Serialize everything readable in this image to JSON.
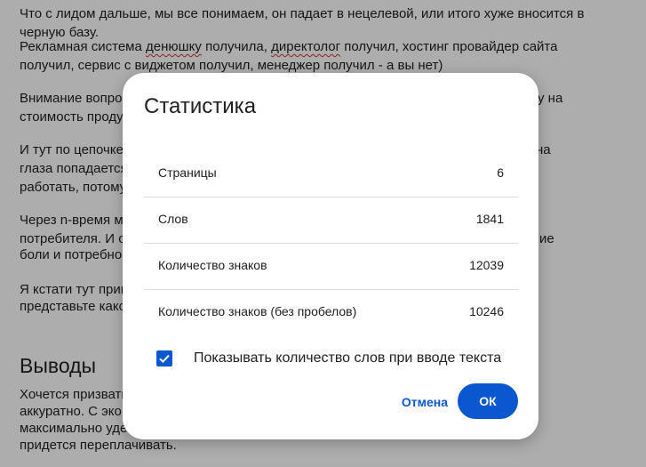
{
  "document": {
    "lines": [
      "Что с лидом дальше, мы все понимаем, он падает в нецелевой, или итого хуже вносится в",
      "черную базу.",
      "Рекламная система денюшку получила, директолог получил, хостинг провайдер сайта",
      "получил, сервис с виджетом получил, менеджер получил - а вы нет)",
      "Внимание вопрос",
      "у на",
      "стоимость проду",
      "И тут по цепочке",
      "на",
      "глаза попадается",
      "работать, потому",
      "Через n-время м",
      "потребителя. И о",
      "ие",
      "боли и потребно",
      "Я кстати тут прив",
      "представьте како",
      "Хочется призвать",
      "аккуратно. С эко",
      "максимально уде",
      "придется переплачивать."
    ],
    "line3_pre": "Рекламная система ",
    "line3_sq1": "денюшку",
    "line3_mid": " получила, ",
    "line3_sq2": "директолог",
    "line3_post": " получил, хостинг провайдер сайта",
    "heading": "Выводы",
    "top_clip": "Что с лидом дальше, мы все понимаем, он падает в нецелевой, или итого хуже вносится в"
  },
  "dialog": {
    "title": "Статистика",
    "stats": [
      {
        "label": "Страницы",
        "value": "6"
      },
      {
        "label": "Слов",
        "value": "1841"
      },
      {
        "label": "Количество знаков",
        "value": "12039"
      },
      {
        "label": "Количество знаков (без пробелов)",
        "value": "10246"
      }
    ],
    "checkbox_label": "Показывать количество слов при вводе текста",
    "checkbox_checked": true,
    "cancel_label": "Отмена",
    "ok_label": "ОК"
  },
  "colors": {
    "accent": "#0b57d0",
    "scrim": "rgba(0,0,0,0.32)",
    "text": "#202124",
    "divider": "#dadce0"
  }
}
